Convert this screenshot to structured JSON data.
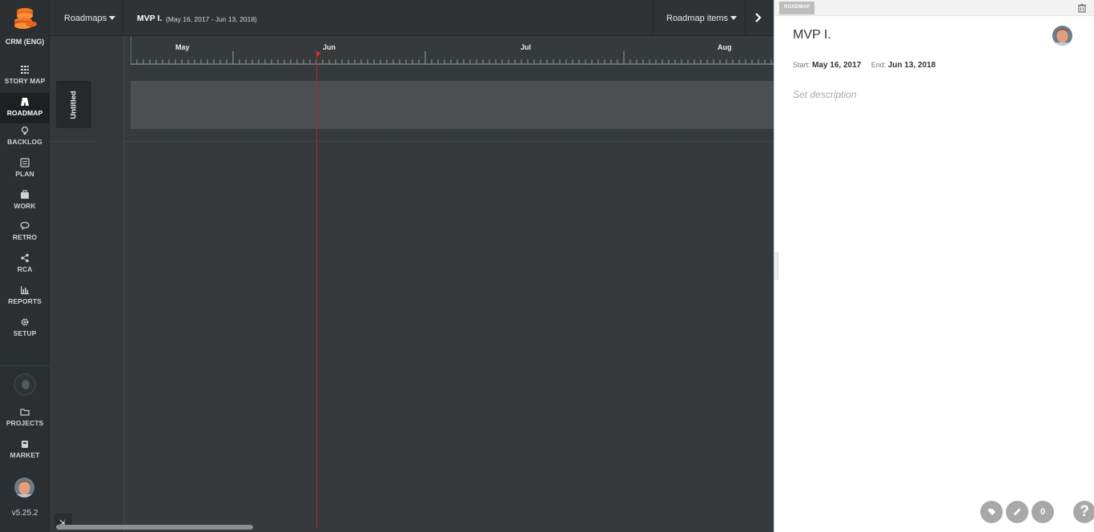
{
  "project": {
    "name": "CRM (ENG)"
  },
  "nav": [
    {
      "label": "STORY MAP",
      "icon": "grid-icon"
    },
    {
      "label": "ROADMAP",
      "icon": "road-icon"
    },
    {
      "label": "BACKLOG",
      "icon": "lightbulb-icon"
    },
    {
      "label": "PLAN",
      "icon": "list-icon"
    },
    {
      "label": "WORK",
      "icon": "briefcase-icon"
    },
    {
      "label": "RETRO",
      "icon": "chat-icon"
    },
    {
      "label": "RCA",
      "icon": "share-icon"
    },
    {
      "label": "REPORTS",
      "icon": "bar-chart-icon"
    },
    {
      "label": "SETUP",
      "icon": "gear-icon"
    }
  ],
  "bottom_nav": [
    {
      "label": "PROJECTS",
      "icon": "folder-icon"
    },
    {
      "label": "MARKET",
      "icon": "basket-icon"
    }
  ],
  "version": "v5.25.2",
  "topbar": {
    "roadmaps_label": "Roadmaps",
    "title": "MVP I.",
    "range": "(May 16, 2017 - Jun 13, 2018)",
    "items_label": "Roadmap items"
  },
  "timeline": {
    "months": [
      "May",
      "Jun",
      "Jul",
      "Aug"
    ],
    "lane_label": "Untitled"
  },
  "panel": {
    "tag": "ROADMAP",
    "title": "MVP I.",
    "start_label": "Start:",
    "start": "May 16, 2017",
    "end_label": "End:",
    "end": "Jun 13, 2018",
    "description_placeholder": "Set description",
    "comment_count": "0",
    "help": "?"
  },
  "colors": {
    "accent": "#e8631c",
    "today_line": "#b2262a"
  }
}
